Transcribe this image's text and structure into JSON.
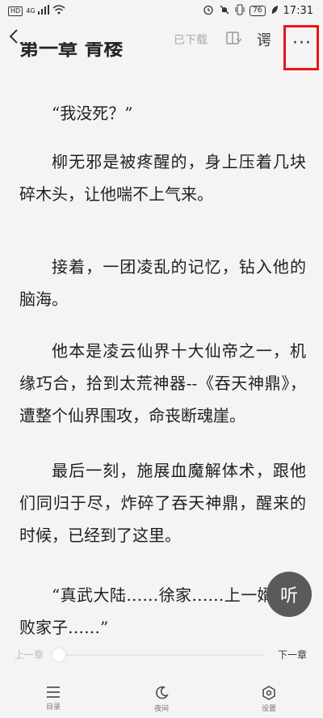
{
  "status_bar": {
    "network_badge": "HD",
    "network_type": "4G",
    "battery_level": "76",
    "time": "17:31"
  },
  "toolbar": {
    "downloaded_label": "已下载",
    "tts_glyph": "谔"
  },
  "book": {
    "chapter_title": "第一章 青楼",
    "paragraphs": [
      "“我没死？”",
      "柳无邪是被疼醒的，身上压着几块碎木头，让他喘不上气来。",
      "接着，一团凌乱的记忆，钻入他的脑海。",
      "他本是凌云仙界十大仙帝之一，机缘巧合，拾到太荒神器--《吞天神鼎》，遭整个仙界围攻，命丧断魂崖。",
      "最后一刻，施展血魔解体术，跟他们同归于尽，炸碎了吞天神鼎，醒来的时候，已经到了这里。",
      "“真武大陆……徐家……上一婿……败家子……”"
    ]
  },
  "listen_label": "听",
  "progress": {
    "prev_label": "上一章",
    "next_label": "下一章",
    "value": 0.0
  },
  "bottom_nav": {
    "items": [
      {
        "label": "目录",
        "icon": "menu-list-icon"
      },
      {
        "label": "夜间",
        "icon": "moon-icon"
      },
      {
        "label": "设置",
        "icon": "settings-icon"
      }
    ]
  }
}
